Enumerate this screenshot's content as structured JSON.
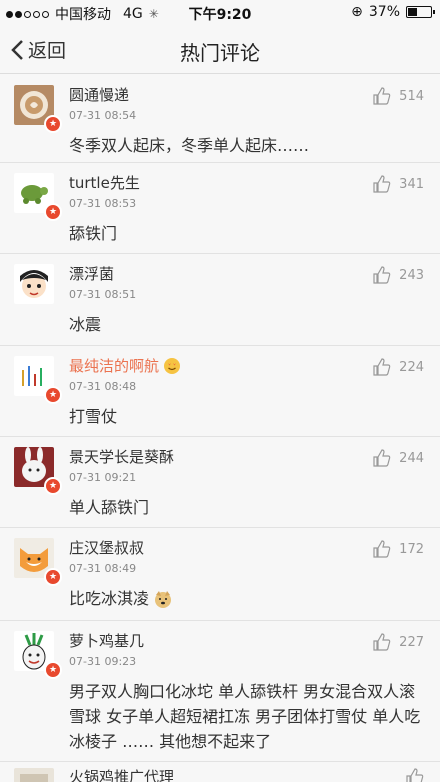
{
  "status_bar": {
    "carrier": "中国移动",
    "network": "4G",
    "time": "下午9:20",
    "battery": "37%",
    "battery_level": 0.37
  },
  "nav": {
    "back_label": "返回",
    "title": "热门评论"
  },
  "comments": [
    {
      "name": "圆通慢递",
      "time": "07-31 08:54",
      "likes": "514",
      "text": "冬季双人起床，冬季单人起床……",
      "avatar": "coffee-avatar"
    },
    {
      "name": "turtle先生",
      "time": "07-31 08:53",
      "likes": "341",
      "text": "舔铁门",
      "avatar": "turtle-avatar"
    },
    {
      "name": "漂浮菌",
      "time": "07-31 08:51",
      "likes": "243",
      "text": "冰震",
      "avatar": "cartoon-boy-avatar"
    },
    {
      "name": "最纯洁的啊航",
      "time": "07-31 08:48",
      "likes": "224",
      "text": "打雪仗",
      "avatar": "chart-avatar"
    },
    {
      "name": "景天学长是葵酥",
      "time": "07-31 09:21",
      "likes": "244",
      "text": "单人舔铁门",
      "avatar": "rabbit-avatar"
    },
    {
      "name": "庄汉堡叔叔",
      "time": "07-31 08:49",
      "likes": "172",
      "text": "比吃冰淇凌",
      "avatar": "fox-avatar"
    },
    {
      "name": "萝卜鸡基几",
      "time": "07-31 09:23",
      "likes": "227",
      "text": "男子双人胸口化冰坨 单人舔铁杆 男女混合双人滚雪球 女子单人超短裙扛冻 男子团体打雪仗 单人吃冰棱子 …… 其他想不起来了",
      "avatar": "radish-avatar"
    },
    {
      "name": "火锅鸡推广代理",
      "time": "",
      "likes": "",
      "text": "",
      "avatar": "partial-avatar"
    }
  ],
  "colors": {
    "vip_name": "#eb7350",
    "badge": "#e8492e",
    "background": "#f7f7f7"
  }
}
